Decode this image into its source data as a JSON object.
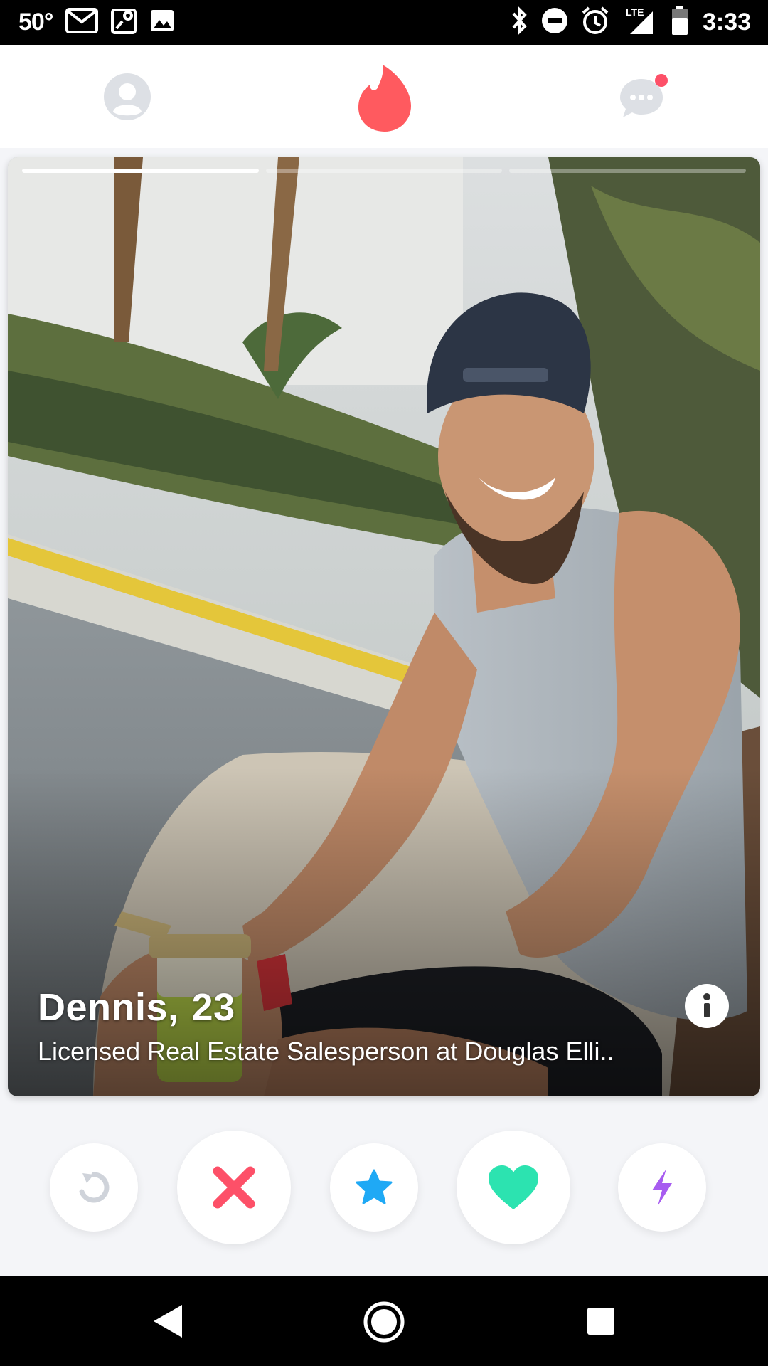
{
  "status_bar": {
    "temperature": "50°",
    "network": "LTE",
    "time": "3:33",
    "icons": [
      "gmail-icon",
      "maps-icon",
      "gallery-icon",
      "bluetooth-icon",
      "do-not-disturb-icon",
      "alarm-icon",
      "signal-icon",
      "battery-icon"
    ]
  },
  "top_nav": {
    "icons": [
      "profile-icon",
      "tinder-flame-icon",
      "messages-icon"
    ],
    "brand_color": "#ff5a5f",
    "inactive_color": "#dde0e5",
    "notification_dot_color": "#fd5068"
  },
  "card": {
    "name": "Dennis,",
    "age": "23",
    "job": "Licensed Real Estate Salesperson at Douglas Elli..",
    "photo_count": 3,
    "active_photo": 1
  },
  "actions": {
    "buttons": [
      "rewind",
      "nope",
      "super-like",
      "like",
      "boost"
    ],
    "colors": {
      "rewind": "#cfd3da",
      "nope": "#fd5068",
      "super_like": "#1fa9f5",
      "like": "#2ce3b0",
      "boost": "#a75cf0"
    }
  },
  "android_nav": {
    "icons": [
      "back-icon",
      "home-icon",
      "recents-icon"
    ]
  }
}
